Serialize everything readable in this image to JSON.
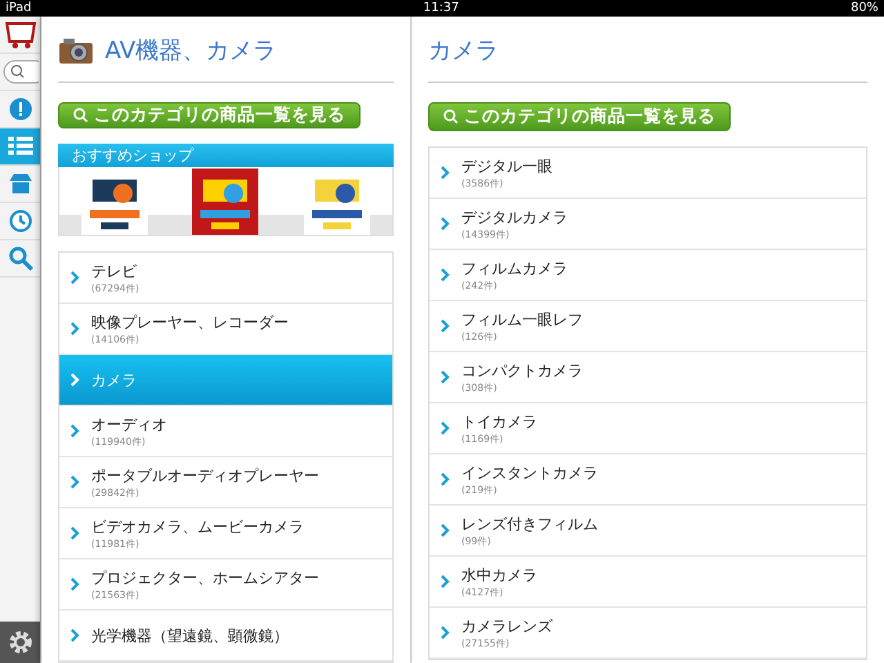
{
  "status_bar": {
    "device": "iPad",
    "time": "11:37",
    "battery": "80%"
  },
  "sidebar": {
    "items": [
      {
        "kind": "info",
        "selected": false
      },
      {
        "kind": "list",
        "selected": true
      },
      {
        "kind": "shop",
        "selected": false
      },
      {
        "kind": "history",
        "selected": false
      },
      {
        "kind": "search",
        "selected": false
      }
    ]
  },
  "left_panel": {
    "title": "AV機器、カメラ",
    "button": "このカテゴリの商品一覧を見る",
    "shops": {
      "title": "おすすめショップ"
    },
    "items": [
      {
        "label": "テレビ",
        "count": "(67294件)",
        "selected": false
      },
      {
        "label": "映像プレーヤー、レコーダー",
        "count": "(14106件)",
        "selected": false
      },
      {
        "label": "カメラ",
        "selected": true
      },
      {
        "label": "オーディオ",
        "count": "(119940件)",
        "selected": false
      },
      {
        "label": "ポータブルオーディオプレーヤー",
        "count": "(29842件)",
        "selected": false
      },
      {
        "label": "ビデオカメラ、ムービーカメラ",
        "count": "(11981件)",
        "selected": false
      },
      {
        "label": "プロジェクター、ホームシアター",
        "count": "(21563件)",
        "selected": false
      },
      {
        "label": "光学機器（望遠鏡、顕微鏡）",
        "selected": false
      }
    ]
  },
  "right_panel": {
    "title": "カメラ",
    "button": "このカテゴリの商品一覧を見る",
    "items": [
      {
        "label": "デジタル一眼",
        "count": "(3586件)",
        "selected": false
      },
      {
        "label": "デジタルカメラ",
        "count": "(14399件)",
        "selected": false
      },
      {
        "label": "フィルムカメラ",
        "count": "(242件)",
        "selected": false
      },
      {
        "label": "フィルム一眼レフ",
        "count": "(126件)",
        "selected": false
      },
      {
        "label": "コンパクトカメラ",
        "count": "(308件)",
        "selected": false
      },
      {
        "label": "トイカメラ",
        "count": "(1169件)",
        "selected": false
      },
      {
        "label": "インスタントカメラ",
        "count": "(219件)",
        "selected": false
      },
      {
        "label": "レンズ付きフィルム",
        "count": "(99件)",
        "selected": false
      },
      {
        "label": "水中カメラ",
        "count": "(4127件)",
        "selected": false
      },
      {
        "label": "カメラレンズ",
        "count": "(27155件)",
        "selected": false
      }
    ]
  }
}
